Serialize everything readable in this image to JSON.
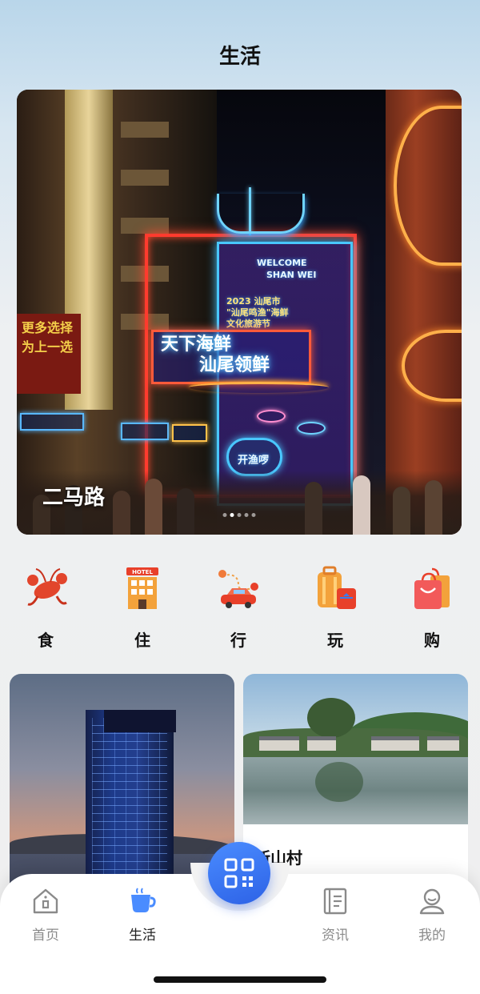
{
  "header": {
    "title": "生活"
  },
  "banner": {
    "caption": "二马路",
    "neon_main_line1": "天下海鲜",
    "neon_main_line2": "汕尾领鲜",
    "neon_welcome": "WELCOME",
    "neon_city": "SHAN WEI",
    "neon_year_line1": "2023 汕尾市",
    "neon_year_line2": "\"汕尾鸣渔\"海鲜",
    "neon_year_line3": "文化旅游节",
    "neon_bubble": "开渔啰",
    "left_banner_text": "更多选择 为上一选",
    "pager": {
      "count": 5,
      "active_index": 1
    }
  },
  "categories": [
    {
      "label": "食",
      "icon": "lobster-icon"
    },
    {
      "label": "住",
      "icon": "hotel-icon"
    },
    {
      "label": "行",
      "icon": "car-route-icon"
    },
    {
      "label": "玩",
      "icon": "luggage-icon"
    },
    {
      "label": "购",
      "icon": "shopping-bag-icon"
    }
  ],
  "cards": [
    {
      "title": "",
      "image": "hotel-tower-photo"
    },
    {
      "title": "新山村",
      "image": "village-lake-photo"
    }
  ],
  "tabbar": {
    "tabs": [
      {
        "label": "首页",
        "icon": "home-icon",
        "active": false
      },
      {
        "label": "生活",
        "icon": "cup-icon",
        "active": true
      },
      {
        "label": "资讯",
        "icon": "news-icon",
        "active": false
      },
      {
        "label": "我的",
        "icon": "user-icon",
        "active": false
      }
    ],
    "center_button": {
      "icon": "qr-scan-icon"
    }
  },
  "colors": {
    "accent": "#2d62e6",
    "tab_active": "#222222",
    "tab_inactive": "#8a8a8a"
  }
}
